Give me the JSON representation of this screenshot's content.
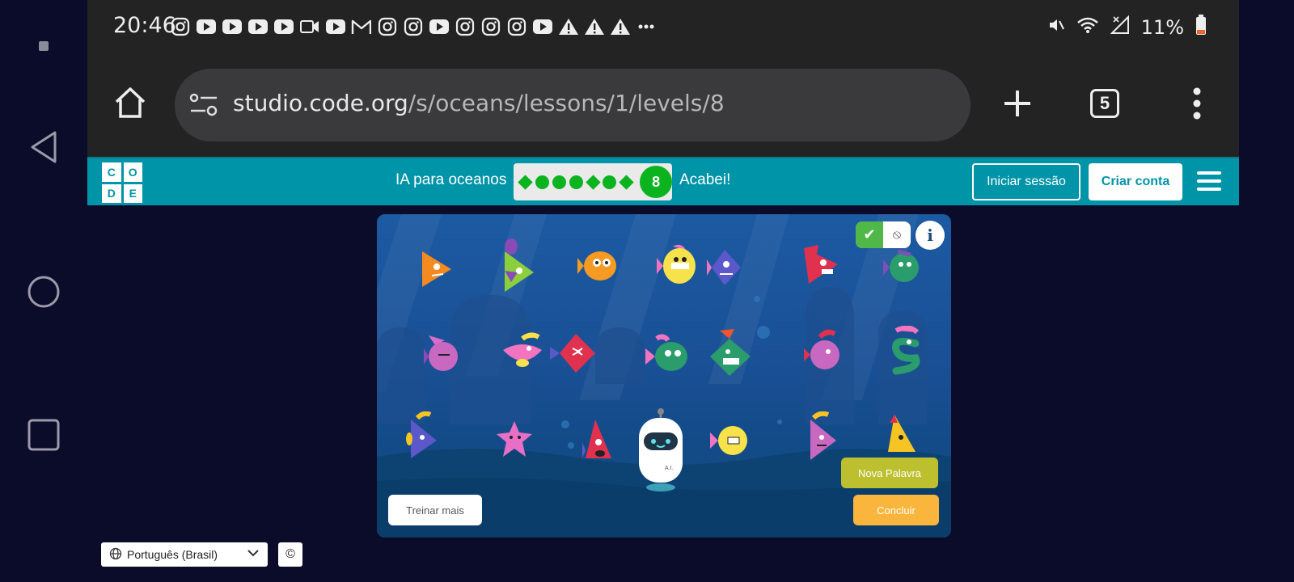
{
  "status": {
    "time": "20:46",
    "battery": "11%",
    "notification_icons": [
      "instagram-icon",
      "youtube-icon",
      "youtube-icon",
      "youtube-icon",
      "youtube-icon",
      "meet-icon",
      "youtube-icon",
      "gmail-icon",
      "instagram-icon",
      "instagram-icon",
      "youtube-icon",
      "instagram-icon",
      "instagram-icon",
      "instagram-icon",
      "youtube-icon",
      "warning-icon",
      "warning-icon",
      "warning-icon",
      "more-icon"
    ]
  },
  "browser": {
    "url_host": "studio.code.org",
    "url_path": "/s/oceans/lessons/1/levels/8",
    "tab_count": "5"
  },
  "header": {
    "logo_letters": [
      "C",
      "O",
      "D",
      "E"
    ],
    "course_title": "IA para oceanos",
    "progress": {
      "completed_levels": 7,
      "current_level": "8"
    },
    "finished_link": "Acabei!",
    "signin_label": "Iniciar sessão",
    "create_account_label": "Criar conta"
  },
  "game": {
    "train_more_label": "Treinar mais",
    "new_word_label": "Nova Palavra",
    "finish_label": "Concluir",
    "robot_label": "A.I.",
    "fish_count": 20
  },
  "footer": {
    "language": "Português (Brasil)",
    "copyright_symbol": "©"
  },
  "colors": {
    "header_bg": "#0094a8",
    "progress_green": "#0bb31f",
    "word_button": "#bcc02e",
    "finish_button": "#f9b53c"
  }
}
